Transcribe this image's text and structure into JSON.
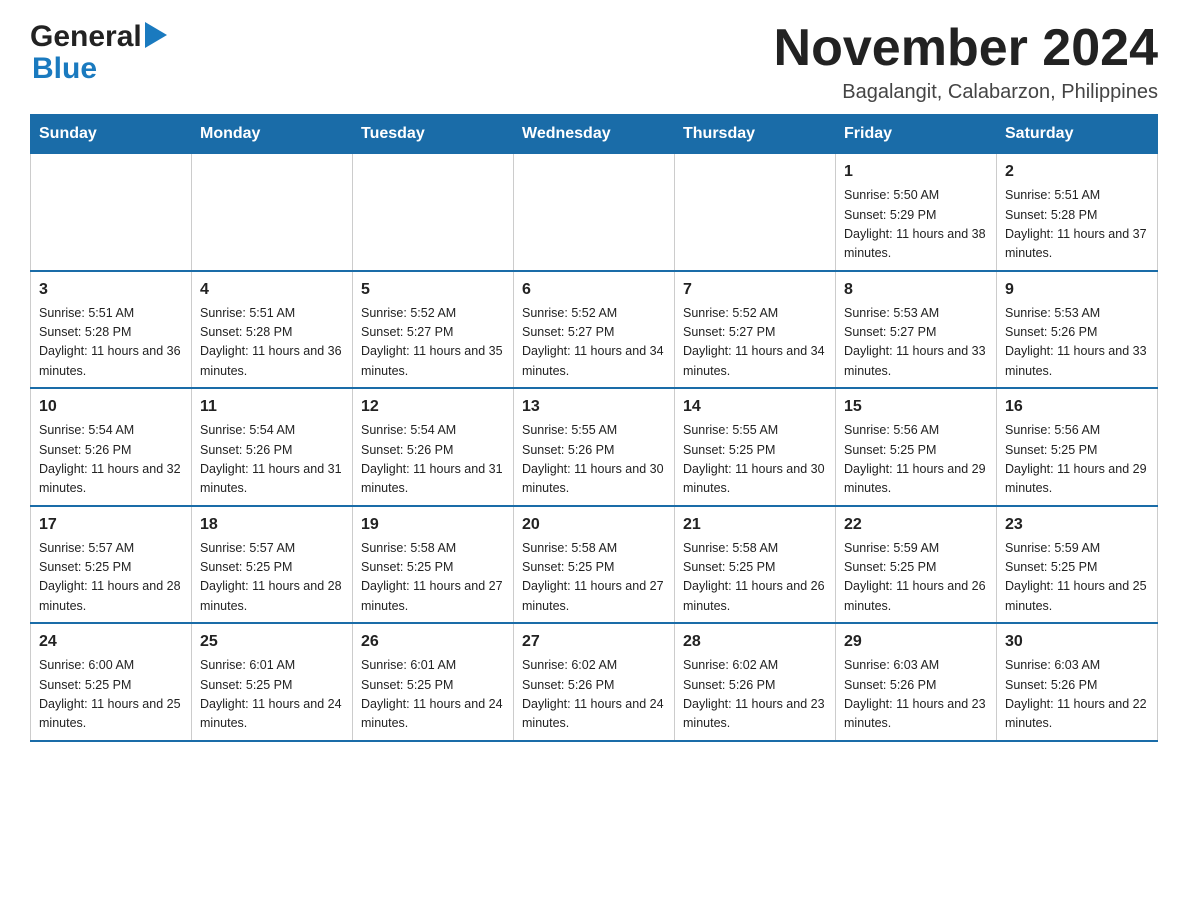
{
  "header": {
    "logo_line1": "General",
    "logo_line2": "Blue",
    "main_title": "November 2024",
    "subtitle": "Bagalangit, Calabarzon, Philippines"
  },
  "calendar": {
    "days_of_week": [
      "Sunday",
      "Monday",
      "Tuesday",
      "Wednesday",
      "Thursday",
      "Friday",
      "Saturday"
    ],
    "weeks": [
      [
        {
          "day": "",
          "sunrise": "",
          "sunset": "",
          "daylight": ""
        },
        {
          "day": "",
          "sunrise": "",
          "sunset": "",
          "daylight": ""
        },
        {
          "day": "",
          "sunrise": "",
          "sunset": "",
          "daylight": ""
        },
        {
          "day": "",
          "sunrise": "",
          "sunset": "",
          "daylight": ""
        },
        {
          "day": "",
          "sunrise": "",
          "sunset": "",
          "daylight": ""
        },
        {
          "day": "1",
          "sunrise": "Sunrise: 5:50 AM",
          "sunset": "Sunset: 5:29 PM",
          "daylight": "Daylight: 11 hours and 38 minutes."
        },
        {
          "day": "2",
          "sunrise": "Sunrise: 5:51 AM",
          "sunset": "Sunset: 5:28 PM",
          "daylight": "Daylight: 11 hours and 37 minutes."
        }
      ],
      [
        {
          "day": "3",
          "sunrise": "Sunrise: 5:51 AM",
          "sunset": "Sunset: 5:28 PM",
          "daylight": "Daylight: 11 hours and 36 minutes."
        },
        {
          "day": "4",
          "sunrise": "Sunrise: 5:51 AM",
          "sunset": "Sunset: 5:28 PM",
          "daylight": "Daylight: 11 hours and 36 minutes."
        },
        {
          "day": "5",
          "sunrise": "Sunrise: 5:52 AM",
          "sunset": "Sunset: 5:27 PM",
          "daylight": "Daylight: 11 hours and 35 minutes."
        },
        {
          "day": "6",
          "sunrise": "Sunrise: 5:52 AM",
          "sunset": "Sunset: 5:27 PM",
          "daylight": "Daylight: 11 hours and 34 minutes."
        },
        {
          "day": "7",
          "sunrise": "Sunrise: 5:52 AM",
          "sunset": "Sunset: 5:27 PM",
          "daylight": "Daylight: 11 hours and 34 minutes."
        },
        {
          "day": "8",
          "sunrise": "Sunrise: 5:53 AM",
          "sunset": "Sunset: 5:27 PM",
          "daylight": "Daylight: 11 hours and 33 minutes."
        },
        {
          "day": "9",
          "sunrise": "Sunrise: 5:53 AM",
          "sunset": "Sunset: 5:26 PM",
          "daylight": "Daylight: 11 hours and 33 minutes."
        }
      ],
      [
        {
          "day": "10",
          "sunrise": "Sunrise: 5:54 AM",
          "sunset": "Sunset: 5:26 PM",
          "daylight": "Daylight: 11 hours and 32 minutes."
        },
        {
          "day": "11",
          "sunrise": "Sunrise: 5:54 AM",
          "sunset": "Sunset: 5:26 PM",
          "daylight": "Daylight: 11 hours and 31 minutes."
        },
        {
          "day": "12",
          "sunrise": "Sunrise: 5:54 AM",
          "sunset": "Sunset: 5:26 PM",
          "daylight": "Daylight: 11 hours and 31 minutes."
        },
        {
          "day": "13",
          "sunrise": "Sunrise: 5:55 AM",
          "sunset": "Sunset: 5:26 PM",
          "daylight": "Daylight: 11 hours and 30 minutes."
        },
        {
          "day": "14",
          "sunrise": "Sunrise: 5:55 AM",
          "sunset": "Sunset: 5:25 PM",
          "daylight": "Daylight: 11 hours and 30 minutes."
        },
        {
          "day": "15",
          "sunrise": "Sunrise: 5:56 AM",
          "sunset": "Sunset: 5:25 PM",
          "daylight": "Daylight: 11 hours and 29 minutes."
        },
        {
          "day": "16",
          "sunrise": "Sunrise: 5:56 AM",
          "sunset": "Sunset: 5:25 PM",
          "daylight": "Daylight: 11 hours and 29 minutes."
        }
      ],
      [
        {
          "day": "17",
          "sunrise": "Sunrise: 5:57 AM",
          "sunset": "Sunset: 5:25 PM",
          "daylight": "Daylight: 11 hours and 28 minutes."
        },
        {
          "day": "18",
          "sunrise": "Sunrise: 5:57 AM",
          "sunset": "Sunset: 5:25 PM",
          "daylight": "Daylight: 11 hours and 28 minutes."
        },
        {
          "day": "19",
          "sunrise": "Sunrise: 5:58 AM",
          "sunset": "Sunset: 5:25 PM",
          "daylight": "Daylight: 11 hours and 27 minutes."
        },
        {
          "day": "20",
          "sunrise": "Sunrise: 5:58 AM",
          "sunset": "Sunset: 5:25 PM",
          "daylight": "Daylight: 11 hours and 27 minutes."
        },
        {
          "day": "21",
          "sunrise": "Sunrise: 5:58 AM",
          "sunset": "Sunset: 5:25 PM",
          "daylight": "Daylight: 11 hours and 26 minutes."
        },
        {
          "day": "22",
          "sunrise": "Sunrise: 5:59 AM",
          "sunset": "Sunset: 5:25 PM",
          "daylight": "Daylight: 11 hours and 26 minutes."
        },
        {
          "day": "23",
          "sunrise": "Sunrise: 5:59 AM",
          "sunset": "Sunset: 5:25 PM",
          "daylight": "Daylight: 11 hours and 25 minutes."
        }
      ],
      [
        {
          "day": "24",
          "sunrise": "Sunrise: 6:00 AM",
          "sunset": "Sunset: 5:25 PM",
          "daylight": "Daylight: 11 hours and 25 minutes."
        },
        {
          "day": "25",
          "sunrise": "Sunrise: 6:01 AM",
          "sunset": "Sunset: 5:25 PM",
          "daylight": "Daylight: 11 hours and 24 minutes."
        },
        {
          "day": "26",
          "sunrise": "Sunrise: 6:01 AM",
          "sunset": "Sunset: 5:25 PM",
          "daylight": "Daylight: 11 hours and 24 minutes."
        },
        {
          "day": "27",
          "sunrise": "Sunrise: 6:02 AM",
          "sunset": "Sunset: 5:26 PM",
          "daylight": "Daylight: 11 hours and 24 minutes."
        },
        {
          "day": "28",
          "sunrise": "Sunrise: 6:02 AM",
          "sunset": "Sunset: 5:26 PM",
          "daylight": "Daylight: 11 hours and 23 minutes."
        },
        {
          "day": "29",
          "sunrise": "Sunrise: 6:03 AM",
          "sunset": "Sunset: 5:26 PM",
          "daylight": "Daylight: 11 hours and 23 minutes."
        },
        {
          "day": "30",
          "sunrise": "Sunrise: 6:03 AM",
          "sunset": "Sunset: 5:26 PM",
          "daylight": "Daylight: 11 hours and 22 minutes."
        }
      ]
    ]
  }
}
